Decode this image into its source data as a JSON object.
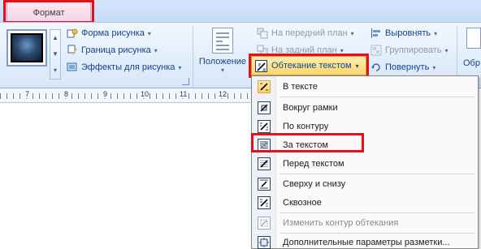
{
  "tabs": {
    "active": "Формат"
  },
  "ribbon": {
    "picture_styles": {
      "shape": "Форма рисунка",
      "border": "Граница рисунка",
      "effects": "Эффекты для рисунка"
    },
    "arrange": {
      "position": "Положение",
      "wrap_text": "Обтекание текстом",
      "bring_front": "На передний план",
      "send_back": "На задний план",
      "align": "Выровнять",
      "group": "Группировать",
      "rotate": "Повернуть"
    },
    "right_cut": "Обр"
  },
  "ruler": {
    "numbers": [
      "7",
      "8",
      "9",
      "10",
      "11",
      "12"
    ]
  },
  "wrap_menu": {
    "items": [
      {
        "label": "В тексте",
        "icon": "inline-wrap-icon"
      },
      {
        "label": "Вокруг рамки",
        "icon": "square-wrap-icon"
      },
      {
        "label": "По контуру",
        "icon": "tight-wrap-icon"
      },
      {
        "label": "За текстом",
        "icon": "behind-text-icon"
      },
      {
        "label": "Перед текстом",
        "icon": "in-front-text-icon"
      },
      {
        "label": "Сверху и снизу",
        "icon": "top-bottom-wrap-icon"
      },
      {
        "label": "Сквозное",
        "icon": "through-wrap-icon"
      },
      {
        "label": "Изменить контур обтекания",
        "icon": "edit-wrap-points-icon"
      },
      {
        "label": "Дополнительные параметры разметки...",
        "icon": "more-layout-options-icon"
      }
    ]
  },
  "colors": {
    "highlight": "#e5101a",
    "hover": "#ffd66b",
    "ribbon_text": "#15428b"
  }
}
